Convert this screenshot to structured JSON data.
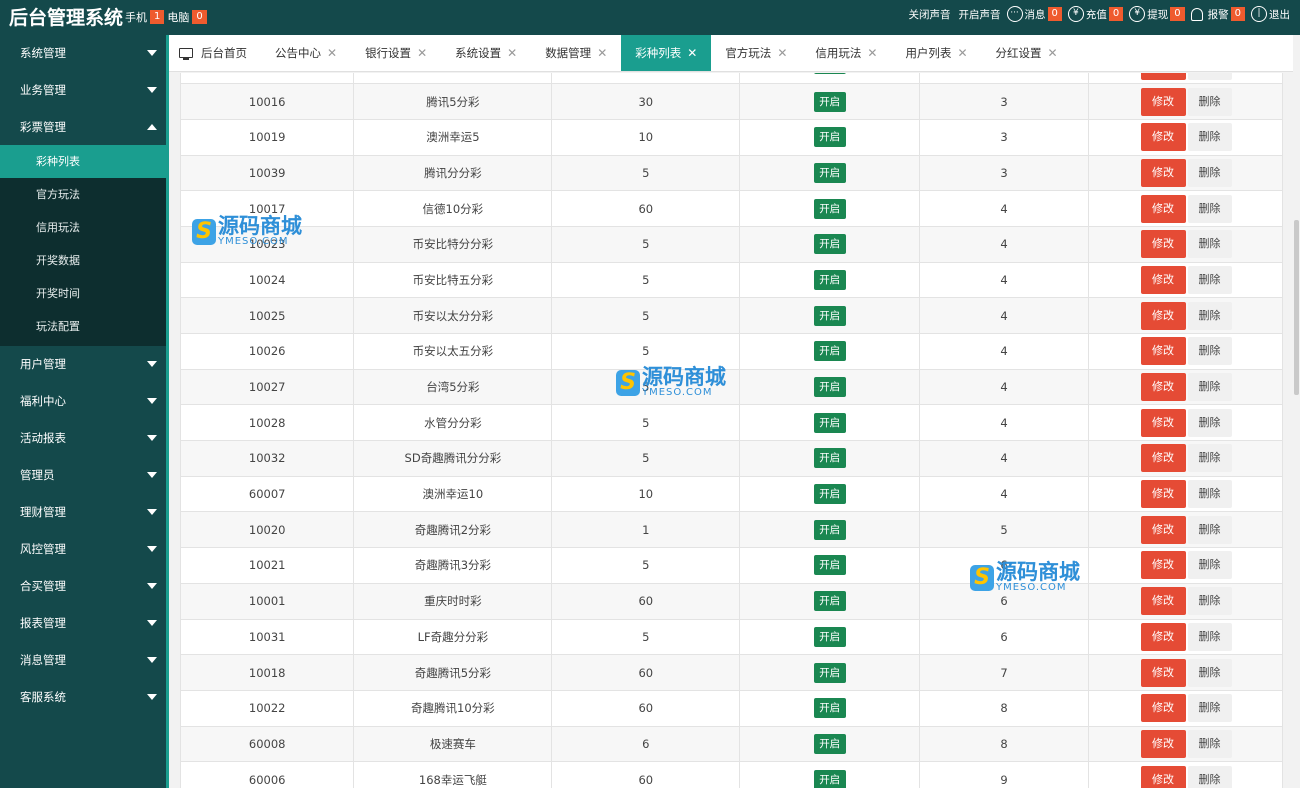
{
  "header": {
    "title": "后台管理系统",
    "mobile_label": "手机",
    "mobile_count": "1",
    "pc_label": "电脑",
    "pc_count": "0",
    "sound_off": "关闭声音",
    "sound_on": "开启声音",
    "message_label": "消息",
    "message_count": "0",
    "recharge_label": "充值",
    "recharge_count": "0",
    "withdraw_label": "提现",
    "withdraw_count": "0",
    "alarm_label": "报警",
    "alarm_count": "0",
    "logout_label": "退出"
  },
  "sidebar": {
    "menus": [
      "系统管理",
      "业务管理",
      "彩票管理",
      "用户管理",
      "福利中心",
      "活动报表",
      "管理员",
      "理财管理",
      "风控管理",
      "合买管理",
      "报表管理",
      "消息管理",
      "客服系统"
    ],
    "submenu": [
      "彩种列表",
      "官方玩法",
      "信用玩法",
      "开奖数据",
      "开奖时间",
      "玩法配置"
    ]
  },
  "tabs": [
    "后台首页",
    "公告中心",
    "银行设置",
    "系统设置",
    "数据管理",
    "彩种列表",
    "官方玩法",
    "信用玩法",
    "用户列表",
    "分红设置"
  ],
  "table": {
    "status_label": "开启",
    "edit_label": "修改",
    "delete_label": "删除",
    "rows": [
      [
        "",
        "",
        "",
        "",
        ""
      ],
      [
        "10016",
        "腾讯5分彩",
        "30",
        "开启",
        "3"
      ],
      [
        "10019",
        "澳洲幸运5",
        "10",
        "开启",
        "3"
      ],
      [
        "10039",
        "腾讯分分彩",
        "5",
        "开启",
        "3"
      ],
      [
        "10017",
        "信德10分彩",
        "60",
        "开启",
        "4"
      ],
      [
        "10023",
        "币安比特分分彩",
        "5",
        "开启",
        "4"
      ],
      [
        "10024",
        "币安比特五分彩",
        "5",
        "开启",
        "4"
      ],
      [
        "10025",
        "币安以太分分彩",
        "5",
        "开启",
        "4"
      ],
      [
        "10026",
        "币安以太五分彩",
        "5",
        "开启",
        "4"
      ],
      [
        "10027",
        "台湾5分彩",
        "5",
        "开启",
        "4"
      ],
      [
        "10028",
        "水管分分彩",
        "5",
        "开启",
        "4"
      ],
      [
        "10032",
        "SD奇趣腾讯分分彩",
        "5",
        "开启",
        "4"
      ],
      [
        "60007",
        "澳洲幸运10",
        "10",
        "开启",
        "4"
      ],
      [
        "10020",
        "奇趣腾讯2分彩",
        "1",
        "开启",
        "5"
      ],
      [
        "10021",
        "奇趣腾讯3分彩",
        "5",
        "开启",
        "6"
      ],
      [
        "10001",
        "重庆时时彩",
        "60",
        "开启",
        "6"
      ],
      [
        "10031",
        "LF奇趣分分彩",
        "5",
        "开启",
        "6"
      ],
      [
        "10018",
        "奇趣腾讯5分彩",
        "60",
        "开启",
        "7"
      ],
      [
        "10022",
        "奇趣腾讯10分彩",
        "60",
        "开启",
        "8"
      ],
      [
        "60008",
        "极速赛车",
        "6",
        "开启",
        "8"
      ],
      [
        "60006",
        "168幸运飞艇",
        "60",
        "开启",
        "9"
      ]
    ]
  },
  "watermark": {
    "title": "源码商城",
    "sub": "YMESO.COM"
  }
}
